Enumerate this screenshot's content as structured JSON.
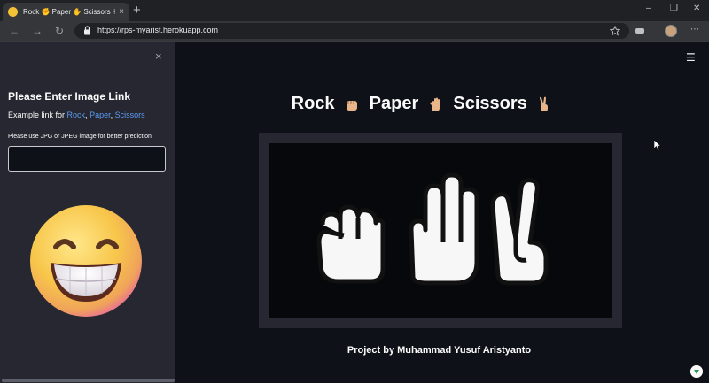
{
  "browser": {
    "tab_title": "Rock ✊ Paper ✋ Scissors ✌ - St",
    "tab_close": "×",
    "new_tab": "+",
    "url": "https://rps-myarist.herokuapp.com",
    "window_controls": {
      "minimize": "–",
      "maximize": "❐",
      "close": "✕"
    }
  },
  "sidebar": {
    "close": "×",
    "heading": "Please Enter Image Link",
    "example_prefix": "Example link for ",
    "links": [
      "Rock",
      "Paper",
      "Scissors"
    ],
    "separator": ", ",
    "hint": "Please use JPG or JPEG image for better prediction",
    "input_value": ""
  },
  "main": {
    "title_words": [
      "Rock",
      "Paper",
      "Scissors"
    ],
    "credit": "Project by Muhammad Yusuf Aristyanto"
  },
  "icons": {
    "hamburger": "☰",
    "lock": "🔒",
    "back": "←",
    "forward": "→",
    "reload": "↻",
    "more": "⋯"
  },
  "colors": {
    "accent_link": "#5b9cf6",
    "sidebar_bg": "#262730",
    "main_bg": "#0e1117"
  }
}
